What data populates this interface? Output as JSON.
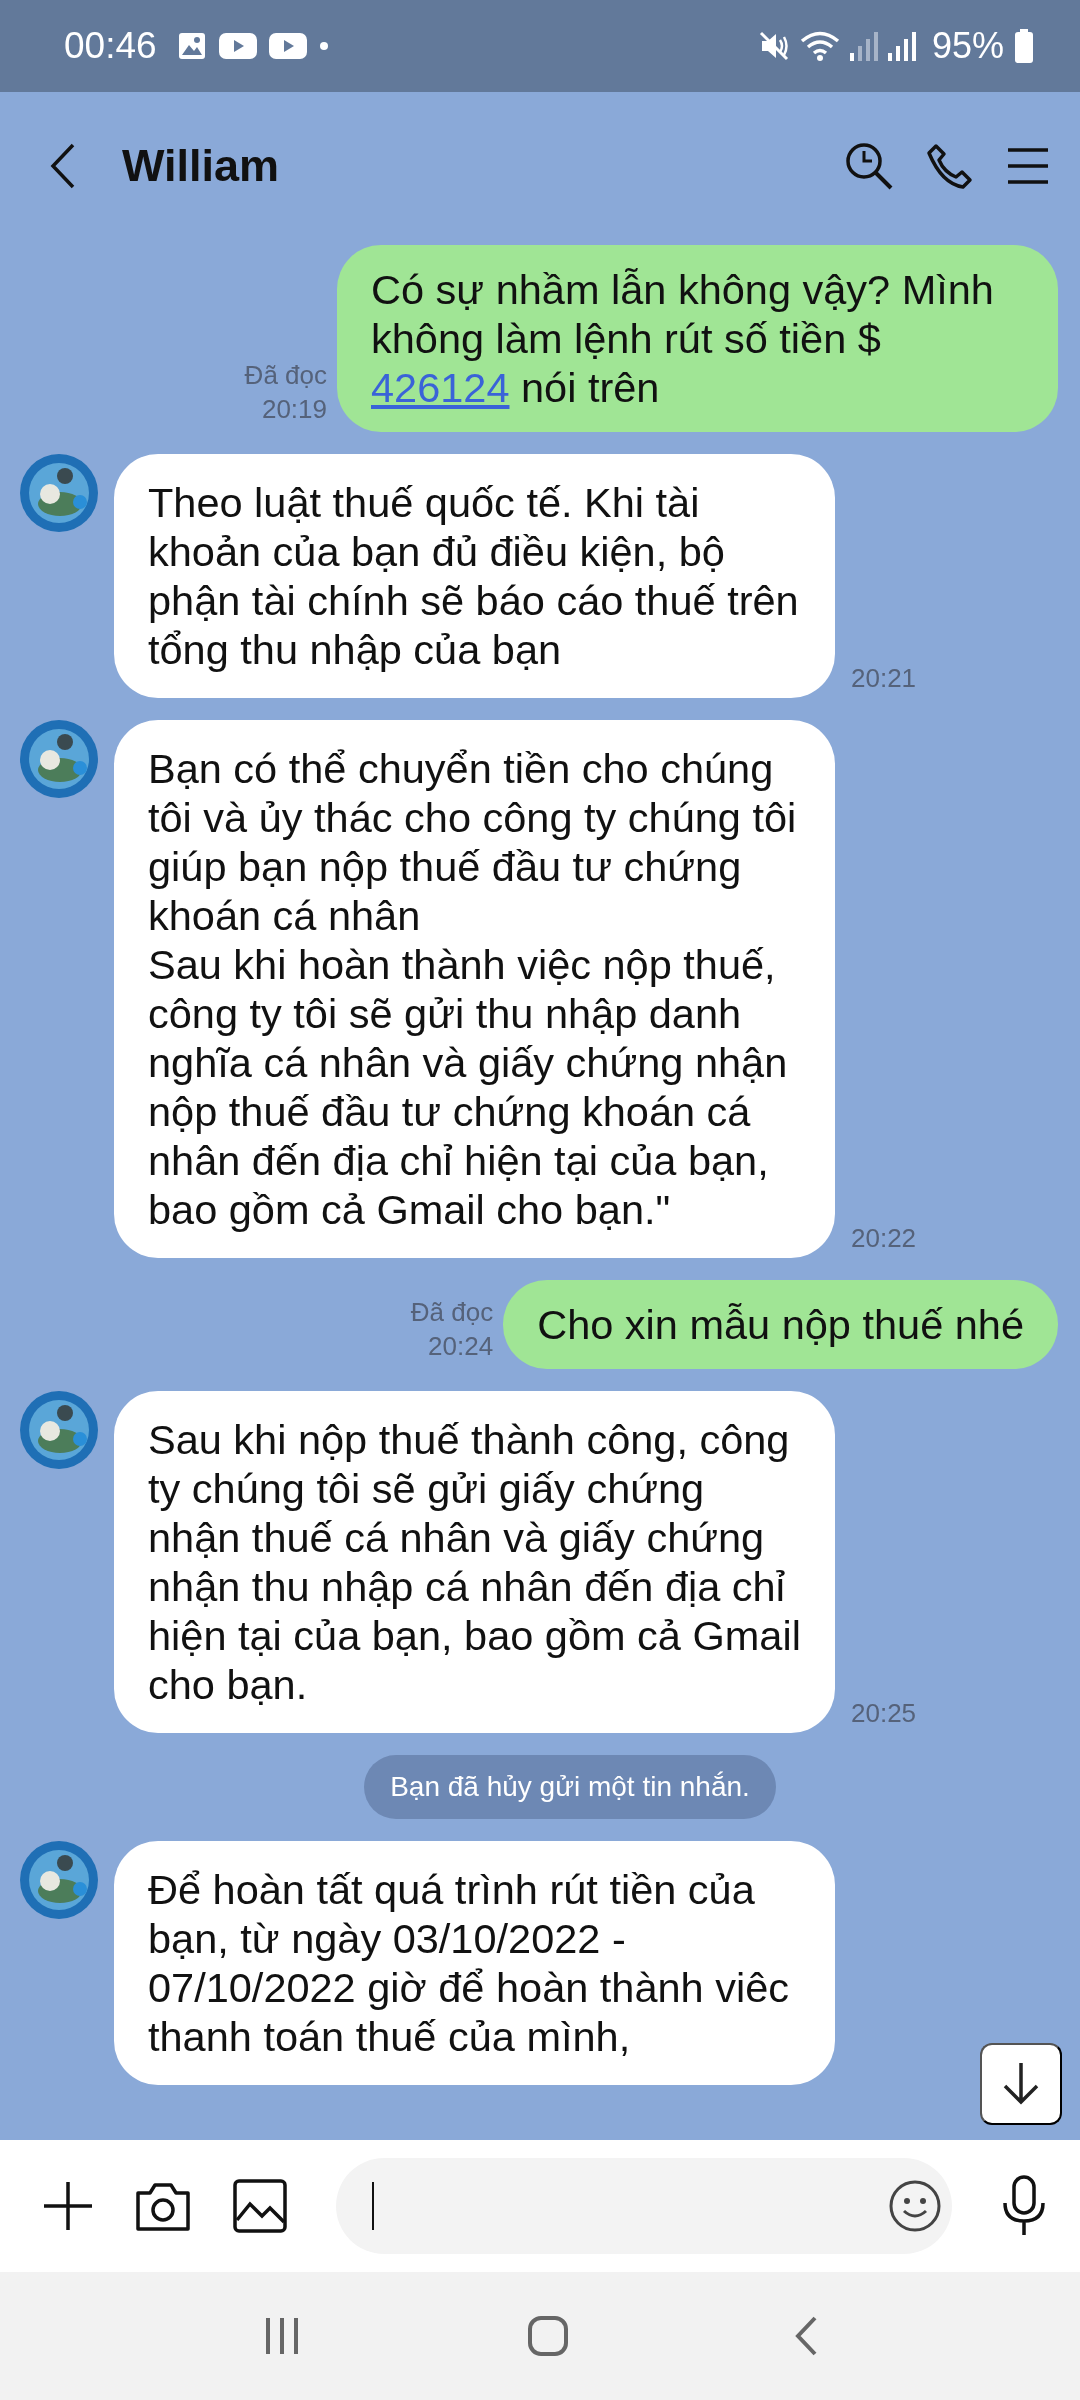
{
  "status_bar": {
    "time": "00:46",
    "battery": "95%"
  },
  "header": {
    "title": "William"
  },
  "messages": [
    {
      "kind": "sent",
      "parts": [
        {
          "kind": "text",
          "text": "Có sự nhầm lẫn không vậy? Mình không làm lệnh rút số tiền $ "
        },
        {
          "kind": "link",
          "text": "426124"
        },
        {
          "kind": "text",
          "text": " nói trên"
        }
      ],
      "read": "Đã đọc",
      "time": "20:19"
    },
    {
      "kind": "received",
      "parts": [
        {
          "kind": "text",
          "text": "Theo luật thuế quốc tế. Khi tài khoản của bạn đủ điều kiện, bộ phận tài chính sẽ báo cáo thuế trên tổng thu nhập của bạn"
        }
      ],
      "time": "20:21"
    },
    {
      "kind": "received",
      "parts": [
        {
          "kind": "text",
          "text": "Bạn có thể chuyển tiền cho chúng tôi và ủy thác cho công ty chúng tôi giúp bạn nộp thuế đầu tư chứng khoán cá nhân\nSau khi hoàn thành việc nộp thuế, công ty tôi sẽ gửi thu nhập danh nghĩa cá nhân và giấy chứng nhận nộp thuế đầu tư chứng khoán cá nhân đến địa chỉ hiện tại của bạn, bao gồm cả Gmail cho bạn.\""
        }
      ],
      "time": "20:22"
    },
    {
      "kind": "sent",
      "parts": [
        {
          "kind": "text",
          "text": "Cho xin mẫu nộp thuế nhé"
        }
      ],
      "read": "Đã đọc",
      "time": "20:24"
    },
    {
      "kind": "received",
      "parts": [
        {
          "kind": "text",
          "text": "Sau khi nộp thuế thành công, công ty chúng tôi sẽ gửi giấy chứng nhận thuế cá nhân và giấy chứng nhận thu nhập cá nhân đến địa chỉ hiện tại của bạn, bao gồm cả Gmail cho bạn."
        }
      ],
      "time": "20:25"
    },
    {
      "kind": "system",
      "text": "Bạn đã hủy gửi một tin nhắn."
    },
    {
      "kind": "received",
      "parts": [
        {
          "kind": "text",
          "text": "Để hoàn tất quá trình rút tiền của bạn, từ ngày 03/10/2022 - 07/10/2022 giờ để hoàn thành viêc thanh toán thuế của mình,"
        }
      ]
    }
  ]
}
